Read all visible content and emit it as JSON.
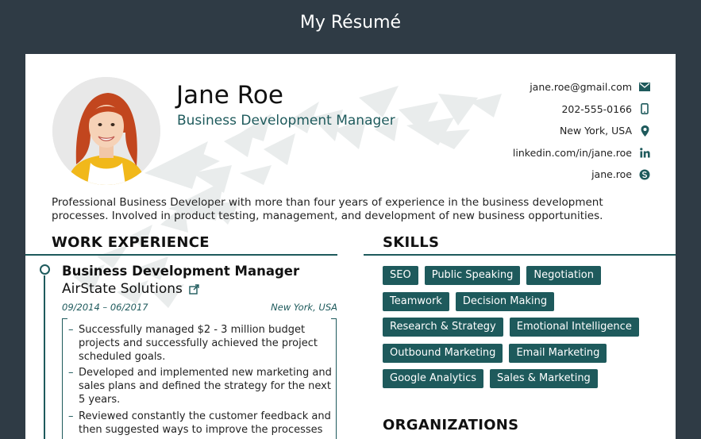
{
  "window": {
    "title": "My Résumé"
  },
  "profile": {
    "name": "Jane Roe",
    "role": "Business Development Manager",
    "photo_icon": "person-photo"
  },
  "contacts": [
    {
      "text": "jane.roe@gmail.com",
      "icon": "envelope-icon"
    },
    {
      "text": "202-555-0166",
      "icon": "phone-icon"
    },
    {
      "text": "New York, USA",
      "icon": "location-pin-icon"
    },
    {
      "text": "linkedin.com/in/jane.roe",
      "icon": "linkedin-icon"
    },
    {
      "text": "jane.roe",
      "icon": "skype-icon"
    }
  ],
  "summary": "Professional Business Developer with more than four years of experience in the business development processes. Involved in product testing, management, and development of new business opportunities.",
  "sections": {
    "work": "WORK EXPERIENCE",
    "skills": "SKILLS",
    "organizations": "ORGANIZATIONS"
  },
  "job": {
    "title": "Business Development Manager",
    "company": "AirState Solutions",
    "dates": "09/2014 – 06/2017",
    "location": "New York, USA",
    "bullets": [
      "Successfully managed $2 - 3 million budget projects and successfully achieved the project scheduled goals.",
      "Developed and implemented new marketing and sales plans and defined the strategy for the next 5 years.",
      "Reviewed constantly the customer feedback and then suggested ways to improve the processes"
    ]
  },
  "skills": [
    "SEO",
    "Public Speaking",
    "Negotiation",
    "Teamwork",
    "Decision Making",
    "Research & Strategy",
    "Emotional Intelligence",
    "Outbound Marketing",
    "Email Marketing",
    "Google Analytics",
    "Sales & Marketing"
  ],
  "colors": {
    "accent": "#1e5a5c",
    "frame": "#2f3b45",
    "paper": "#ffffff"
  }
}
